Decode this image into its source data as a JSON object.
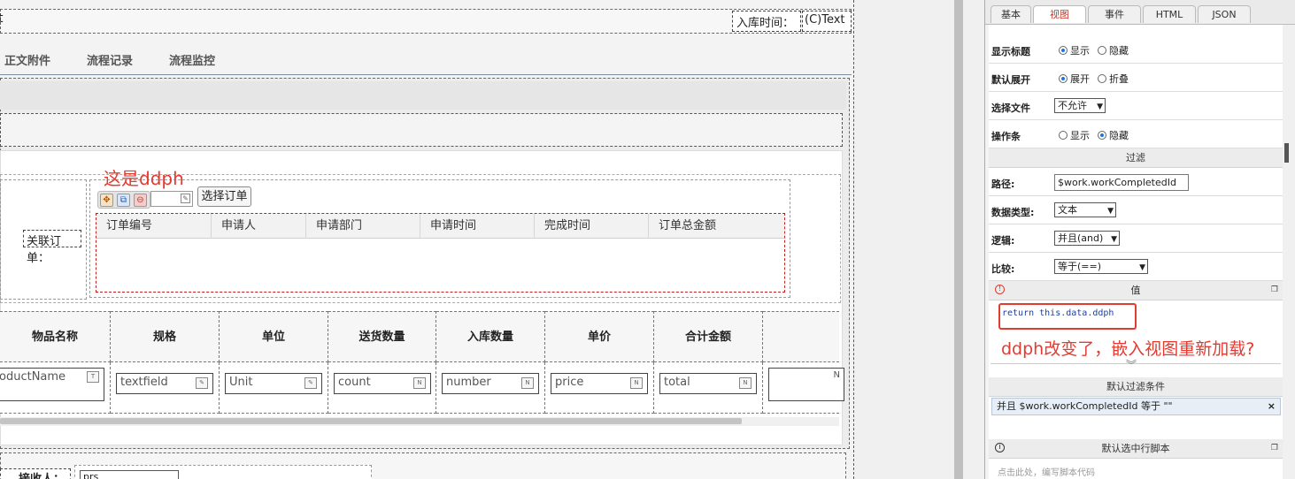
{
  "left": {
    "title_fragment": "t",
    "inbound_time_label": "入库时间：",
    "inbound_time_value": "(C)Text",
    "tabs": [
      "正文附件",
      "流程记录",
      "流程监控"
    ],
    "annotation": "这是ddph",
    "related_order_label": "关联订单：",
    "select_order_button": "选择订单",
    "order_grid_columns": [
      "订单编号",
      "申请人",
      "申请部门",
      "申请时间",
      "完成时间",
      "订单总金额"
    ],
    "product_columns": [
      "物品名称",
      "规格",
      "单位",
      "送货数量",
      "入库数量",
      "单价",
      "合计金额"
    ],
    "product_inputs": [
      "oductName",
      "textfield",
      "Unit",
      "count",
      "number",
      "price",
      "total",
      "N"
    ],
    "sender_label": "接收人：",
    "sender_value": "prs"
  },
  "right": {
    "tabs": [
      "基本",
      "视图",
      "事件",
      "HTML",
      "JSON"
    ],
    "active_tab": "视图",
    "show_title": {
      "label": "显示标题",
      "opt_on": "显示",
      "opt_off": "隐藏"
    },
    "default_expand": {
      "label": "默认展开",
      "opt_on": "展开",
      "opt_off": "折叠"
    },
    "select_file": {
      "label": "选择文件",
      "value": "不允许"
    },
    "action_bar": {
      "label": "操作条",
      "opt_on": "显示",
      "opt_off": "隐藏"
    },
    "filter_section": "过滤",
    "path": {
      "label": "路径:",
      "value": "$work.workCompletedId"
    },
    "data_type": {
      "label": "数据类型:",
      "value": "文本"
    },
    "logic": {
      "label": "逻辑:",
      "value": "并且(and)"
    },
    "compare": {
      "label": "比较:",
      "value": "等于(==)"
    },
    "value_section": "值",
    "code": "return this.data.ddph",
    "annotation": "ddph改变了，嵌入视图重新加载?",
    "default_filter_section": "默认过滤条件",
    "filter_item": "并且 $work.workCompletedId 等于 \"\"",
    "filter_remove": "×",
    "default_row_script_section": "默认选中行脚本",
    "script_hint": "点击此处，编写脚本代码"
  }
}
